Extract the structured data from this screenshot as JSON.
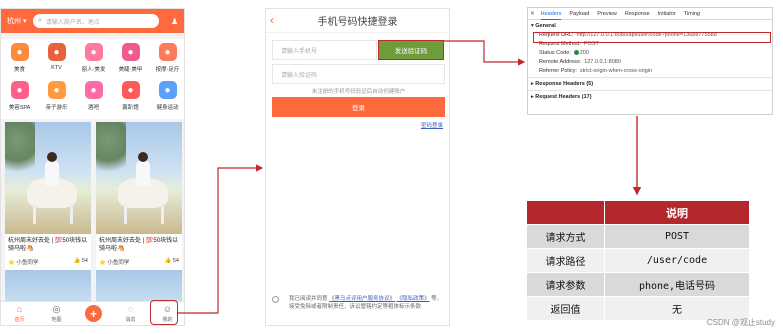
{
  "colors": {
    "brand": "#ff6a3d",
    "highlight": "#c0282d",
    "table_header": "#b4272c",
    "code_button": "#6f9c3a",
    "link": "#3f5fbf"
  },
  "phone1": {
    "city": "杭州 ▾",
    "search_placeholder": "请输入商户名、地点",
    "search_icon": "search-icon",
    "user_icon": "user-icon",
    "categories": [
      {
        "label": "美食",
        "icon": "food-icon",
        "color": "#ff8a3d"
      },
      {
        "label": "KTV",
        "icon": "microphone-icon",
        "color": "#e8613a"
      },
      {
        "label": "丽人·美发",
        "icon": "hair-icon",
        "color": "#ff7aa0"
      },
      {
        "label": "美睫·美甲",
        "icon": "nail-icon",
        "color": "#f05a8c"
      },
      {
        "label": "按摩·足疗",
        "icon": "massage-icon",
        "color": "#ff7a5a"
      },
      {
        "label": "美容SPA",
        "icon": "spa-icon",
        "color": "#ff5f8a"
      },
      {
        "label": "亲子游乐",
        "icon": "kids-icon",
        "color": "#ff9a3d"
      },
      {
        "label": "酒吧",
        "icon": "cocktail-icon",
        "color": "#ff6aa8"
      },
      {
        "label": "轰趴馆",
        "icon": "party-icon",
        "color": "#ff5a5a"
      },
      {
        "label": "健身运动",
        "icon": "fitness-icon",
        "color": "#5aa0ff"
      }
    ],
    "cards": [
      {
        "title": "杭州周末好去处 | 💯50块钱以骑马啦🐴",
        "author": "⭐ 小鱼同学",
        "likes": "👍 54"
      },
      {
        "title": "杭州周末好去处 | 💯50块钱以骑马啦🐴",
        "author": "⭐ 小鱼同学",
        "likes": "👍 54"
      }
    ],
    "nav": [
      {
        "label": "首页",
        "icon": "home-icon",
        "glyph": "⌂",
        "active": true
      },
      {
        "label": "地图",
        "icon": "map-pin-icon",
        "glyph": "◎",
        "active": false
      },
      {
        "label": "",
        "icon": "plus-icon",
        "glyph": "+",
        "active": false
      },
      {
        "label": "消息",
        "icon": "message-icon",
        "glyph": "◌",
        "active": false
      },
      {
        "label": "我的",
        "icon": "profile-icon",
        "glyph": "☺",
        "active": false
      }
    ]
  },
  "phone2": {
    "back_icon": "back-arrow-icon",
    "title": "手机号码快捷登录",
    "phone_placeholder": "请输入手机号",
    "code_button": "发送验证码",
    "code_placeholder": "请输入验证码",
    "hint": "未注册的手机号码验证后自动创建账户",
    "login_button": "登录",
    "password_login": "密码登录",
    "agree_prefix": "我已阅读并同意",
    "agree_link1": "《黑马点评用户服务协议》",
    "agree_link2": "《隐私政策》",
    "agree_suffix": "等，接受免除或者限制责任、诉讼管辖约定等粗体标示条款"
  },
  "devtools": {
    "close_icon": "close-icon",
    "tabs": [
      "Headers",
      "Payload",
      "Preview",
      "Response",
      "Initiator",
      "Timing"
    ],
    "active_tab": "Headers",
    "general": "▾ General",
    "request_url_key": "Request URL:",
    "request_url": "http://127.0.0.1:8080/api/user/code?phone=13688775588",
    "method_key": "Request Method:",
    "method": "POST",
    "status_key": "Status Code:",
    "status": "200",
    "remote_key": "Remote Address:",
    "remote": "127.0.0.1:8080",
    "referrer_key": "Referrer Policy:",
    "referrer": "strict-origin-when-cross-origin",
    "response_headers": "▸ Response Headers (5)",
    "request_headers": "▸ Request Headers (17)"
  },
  "table": {
    "header": [
      "",
      "说明"
    ],
    "rows": [
      {
        "key": "请求方式",
        "value": "POST"
      },
      {
        "key": "请求路径",
        "value": "/user/code"
      },
      {
        "key": "请求参数",
        "value": "phone,电话号码"
      },
      {
        "key": "返回值",
        "value": "无"
      }
    ]
  },
  "watermark": "CSDN @观止study"
}
